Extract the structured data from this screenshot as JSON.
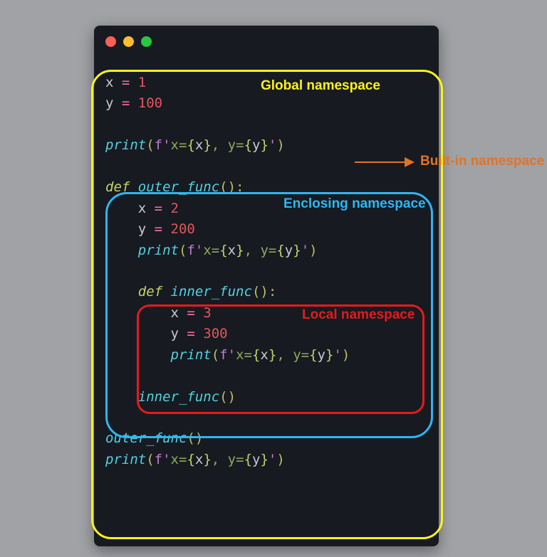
{
  "labels": {
    "global": "Global namespace",
    "enclosing": "Enclosing namespace",
    "local": "Local namespace",
    "builtin": "Built-in namespace"
  },
  "code": {
    "l1_x": "x",
    "l1_eq": " = ",
    "l1_v": "1",
    "l2_y": "y",
    "l2_eq": " = ",
    "l2_v": "100",
    "l4_print": "print",
    "l4_open": "(",
    "l4_f": "f'",
    "l4_s1": "x=",
    "l4_b1o": "{",
    "l4_xv": "x",
    "l4_b1c": "}",
    "l4_s2": ", y=",
    "l4_b2o": "{",
    "l4_yv": "y",
    "l4_b2c": "}",
    "l4_fend": "'",
    "l4_close": ")",
    "l6_def": "def",
    "l6_sp": " ",
    "l6_name": "outer_func",
    "l6_par": "():",
    "l7_ind": "    ",
    "l7_x": "x",
    "l7_eq": " = ",
    "l7_v": "2",
    "l8_ind": "    ",
    "l8_y": "y",
    "l8_eq": " = ",
    "l8_v": "200",
    "l9_ind": "    ",
    "l9_print": "print",
    "l9_open": "(",
    "l9_f": "f'",
    "l9_s1": "x=",
    "l9_b1o": "{",
    "l9_xv": "x",
    "l9_b1c": "}",
    "l9_s2": ", y=",
    "l9_b2o": "{",
    "l9_yv": "y",
    "l9_b2c": "}",
    "l9_fend": "'",
    "l9_close": ")",
    "l11_ind": "    ",
    "l11_def": "def",
    "l11_sp": " ",
    "l11_name": "inner_func",
    "l11_par": "():",
    "l12_ind": "        ",
    "l12_x": "x",
    "l12_eq": " = ",
    "l12_v": "3",
    "l13_ind": "        ",
    "l13_y": "y",
    "l13_eq": " = ",
    "l13_v": "300",
    "l14_ind": "        ",
    "l14_print": "print",
    "l14_open": "(",
    "l14_f": "f'",
    "l14_s1": "x=",
    "l14_b1o": "{",
    "l14_xv": "x",
    "l14_b1c": "}",
    "l14_s2": ", y=",
    "l14_b2o": "{",
    "l14_yv": "y",
    "l14_b2c": "}",
    "l14_fend": "'",
    "l14_close": ")",
    "l16_ind": "    ",
    "l16_call": "inner_func",
    "l16_par": "()",
    "l18_call": "outer_func",
    "l18_par": "()",
    "l19_print": "print",
    "l19_open": "(",
    "l19_f": "f'",
    "l19_s1": "x=",
    "l19_b1o": "{",
    "l19_xv": "x",
    "l19_b1c": "}",
    "l19_s2": ", y=",
    "l19_b2o": "{",
    "l19_yv": "y",
    "l19_b2c": "}",
    "l19_fend": "'",
    "l19_close": ")"
  }
}
